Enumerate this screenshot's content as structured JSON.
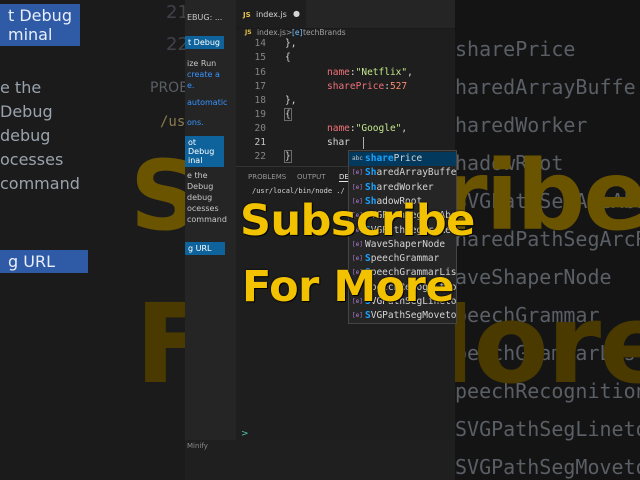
{
  "overlay": {
    "subscribe": "Subscribe",
    "for_more": "For More",
    "color": "#f2c200"
  },
  "background": {
    "left_buttons": [
      "t Debug",
      "minal",
      "g URL"
    ],
    "left_lines": [
      "e the",
      "Debug",
      "debug",
      "ocesses",
      "command"
    ],
    "line_nums": [
      "21",
      "22"
    ],
    "prob": "PROB",
    "us": "/us",
    "right_lines": [
      "sharePrice",
      "haredArrayBuffe",
      "haredWorker",
      "hadowRoot",
      "SVGPathSegArcAbs",
      "haredPathSegArcRel",
      "aveShaperNode",
      "peechGrammar",
      "peechGrammarList",
      "peechRecognition",
      "SVGPathSegLineto",
      "SVGPathSegMoveto"
    ]
  },
  "sidebar": {
    "title": "EBUG: ...",
    "button1": "t Debug",
    "text1": [
      "ize Run",
      "create a",
      "e."
    ],
    "link1": "automatic",
    "text_ons": "ons.",
    "button2_lines": [
      "ot Debug",
      "inal"
    ],
    "text2": [
      "e the",
      "Debug",
      "debug",
      "ocesses",
      "command"
    ],
    "button3": "g URL",
    "minify": "Minify"
  },
  "editor": {
    "tab": {
      "badge": "JS",
      "filename": "index.js",
      "modified": "●"
    },
    "breadcrumb": {
      "file_badge": "JS",
      "file": "index.js",
      "sep": ">",
      "symbol_icon": "[e]",
      "symbol": "techBrands"
    },
    "lines": [
      {
        "num": "14",
        "text": "},"
      },
      {
        "num": "15",
        "text": "{"
      },
      {
        "num": "16",
        "key": "name",
        "value": "\"Netflix\""
      },
      {
        "num": "17",
        "key": "sharePrice",
        "value": "527"
      },
      {
        "num": "18",
        "text": "},"
      },
      {
        "num": "19",
        "text": "{"
      },
      {
        "num": "20",
        "key": "name",
        "value": "\"Google\""
      },
      {
        "num": "21",
        "typed": "shar"
      },
      {
        "num": "22",
        "text": "}"
      }
    ]
  },
  "terminal": {
    "tabs": [
      "PROBLEMS",
      "OUTPUT",
      "DEB"
    ],
    "active_tab": "DEB",
    "path": "/usr/local/bin/node ./",
    "prompt": ">"
  },
  "suggest": {
    "typed": "shar",
    "items": [
      {
        "icon": "abc",
        "match": "share",
        "rest": "Price",
        "selected": true
      },
      {
        "icon": "[e]",
        "match": "Sh",
        "rest": "aredArrayBuffe"
      },
      {
        "icon": "[e]",
        "match": "Sh",
        "rest": "aredWorker"
      },
      {
        "icon": "[e]",
        "match": "Sh",
        "rest": "adowRoot"
      },
      {
        "icon": "[e]",
        "match": "S",
        "rest": "VGPathSegArcAbs"
      },
      {
        "icon": "[e]",
        "match": "S",
        "rest": "VGPathSegArcRel"
      },
      {
        "icon": "[e]",
        "match": "",
        "rest": "WaveShaperNode"
      },
      {
        "icon": "[e]",
        "match": "S",
        "rest": "peechGrammar"
      },
      {
        "icon": "[e]",
        "match": "S",
        "rest": "peechGrammarLis"
      },
      {
        "icon": "[e]",
        "match": "S",
        "rest": "peechRecognitio"
      },
      {
        "icon": "[e]",
        "match": "S",
        "rest": "VGPathSegLineto"
      },
      {
        "icon": "[e]",
        "match": "S",
        "rest": "VGPathSegMoveto"
      }
    ]
  }
}
